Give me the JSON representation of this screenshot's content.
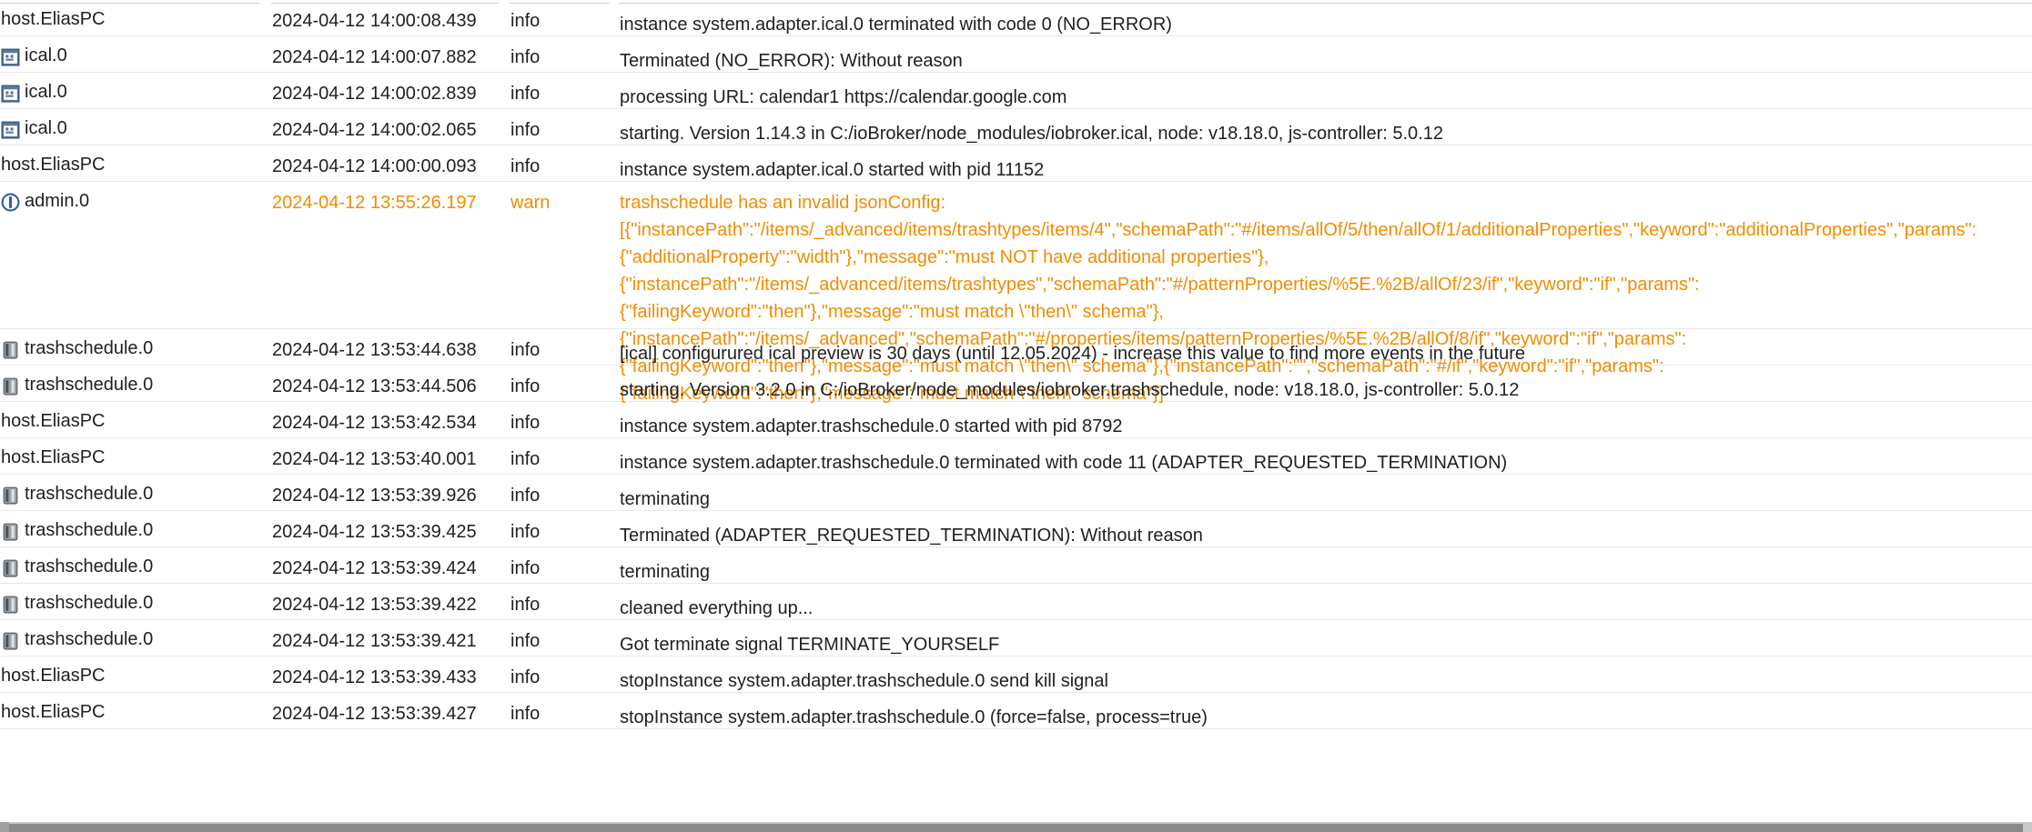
{
  "rows": [
    {
      "source": "host.EliasPC",
      "icon": "",
      "time": "2024-04-12 14:00:08.439",
      "severity": "info",
      "lines": [
        "instance system.adapter.ical.0 terminated with code 0 (NO_ERROR)"
      ]
    },
    {
      "source": "ical.0",
      "icon": "calendar-icon",
      "time": "2024-04-12 14:00:07.882",
      "severity": "info",
      "lines": [
        "Terminated (NO_ERROR): Without reason"
      ]
    },
    {
      "source": "ical.0",
      "icon": "calendar-icon",
      "time": "2024-04-12 14:00:02.839",
      "severity": "info",
      "lines": [
        "processing URL: calendar1 https://calendar.google.com"
      ]
    },
    {
      "source": "ical.0",
      "icon": "calendar-icon",
      "time": "2024-04-12 14:00:02.065",
      "severity": "info",
      "lines": [
        "starting. Version 1.14.3 in C:/ioBroker/node_modules/iobroker.ical, node: v18.18.0, js-controller: 5.0.12"
      ]
    },
    {
      "source": "host.EliasPC",
      "icon": "",
      "time": "2024-04-12 14:00:00.093",
      "severity": "info",
      "lines": [
        "instance system.adapter.ical.0 started with pid 11152"
      ]
    },
    {
      "source": "admin.0",
      "icon": "admin-icon",
      "time": "2024-04-12 13:55:26.197",
      "severity": "warn",
      "lines": [
        "trashschedule has an invalid jsonConfig:",
        "[{\"instancePath\":\"/items/_advanced/items/trashtypes/items/4\",\"schemaPath\":\"#/items/allOf/5/then/allOf/1/additionalProperties\",\"keyword\":\"additionalProperties\",\"params\":",
        "{\"additionalProperty\":\"width\"},\"message\":\"must NOT have additional properties\"},",
        "{\"instancePath\":\"/items/_advanced/items/trashtypes\",\"schemaPath\":\"#/patternProperties/%5E.%2B/allOf/23/if\",\"keyword\":\"if\",\"params\":",
        "{\"failingKeyword\":\"then\"},\"message\":\"must match \\\"then\\\" schema\"},",
        "{\"instancePath\":\"/items/_advanced\",\"schemaPath\":\"#/properties/items/patternProperties/%5E.%2B/allOf/8/if\",\"keyword\":\"if\",\"params\":",
        "{\"failingKeyword\":\"then\"},\"message\":\"must match \\\"then\\\" schema\"},{\"instancePath\":\"\",\"schemaPath\":\"#/if\",\"keyword\":\"if\",\"params\":",
        "{\"failingKeyword\":\"then\"},\"message\":\"must match \\\"then\\\" schema\"}]"
      ]
    },
    {
      "source": "trashschedule.0",
      "icon": "trash-icon",
      "time": "2024-04-12 13:53:44.638",
      "severity": "info",
      "lines": [
        "[ical] configurured ical preview is 30 days (until 12.05.2024) - increase this value to find more events in the future"
      ]
    },
    {
      "source": "trashschedule.0",
      "icon": "trash-icon",
      "time": "2024-04-12 13:53:44.506",
      "severity": "info",
      "lines": [
        "starting. Version 3.2.0 in C:/ioBroker/node_modules/iobroker.trashschedule, node: v18.18.0, js-controller: 5.0.12"
      ]
    },
    {
      "source": "host.EliasPC",
      "icon": "",
      "time": "2024-04-12 13:53:42.534",
      "severity": "info",
      "lines": [
        "instance system.adapter.trashschedule.0 started with pid 8792"
      ]
    },
    {
      "source": "host.EliasPC",
      "icon": "",
      "time": "2024-04-12 13:53:40.001",
      "severity": "info",
      "lines": [
        "instance system.adapter.trashschedule.0 terminated with code 11 (ADAPTER_REQUESTED_TERMINATION)"
      ]
    },
    {
      "source": "trashschedule.0",
      "icon": "trash-icon",
      "time": "2024-04-12 13:53:39.926",
      "severity": "info",
      "lines": [
        "terminating"
      ]
    },
    {
      "source": "trashschedule.0",
      "icon": "trash-icon",
      "time": "2024-04-12 13:53:39.425",
      "severity": "info",
      "lines": [
        "Terminated (ADAPTER_REQUESTED_TERMINATION): Without reason"
      ]
    },
    {
      "source": "trashschedule.0",
      "icon": "trash-icon",
      "time": "2024-04-12 13:53:39.424",
      "severity": "info",
      "lines": [
        "terminating"
      ]
    },
    {
      "source": "trashschedule.0",
      "icon": "trash-icon",
      "time": "2024-04-12 13:53:39.422",
      "severity": "info",
      "lines": [
        "cleaned everything up..."
      ]
    },
    {
      "source": "trashschedule.0",
      "icon": "trash-icon",
      "time": "2024-04-12 13:53:39.421",
      "severity": "info",
      "lines": [
        "Got terminate signal TERMINATE_YOURSELF"
      ]
    },
    {
      "source": "host.EliasPC",
      "icon": "",
      "time": "2024-04-12 13:53:39.433",
      "severity": "info",
      "lines": [
        "stopInstance system.adapter.trashschedule.0 send kill signal"
      ]
    },
    {
      "source": "host.EliasPC",
      "icon": "",
      "time": "2024-04-12 13:53:39.427",
      "severity": "info",
      "lines": [
        "stopInstance system.adapter.trashschedule.0 (force=false, process=true)"
      ]
    }
  ],
  "colors": {
    "warn": "#f28c00",
    "info": "#1f1f1f"
  }
}
